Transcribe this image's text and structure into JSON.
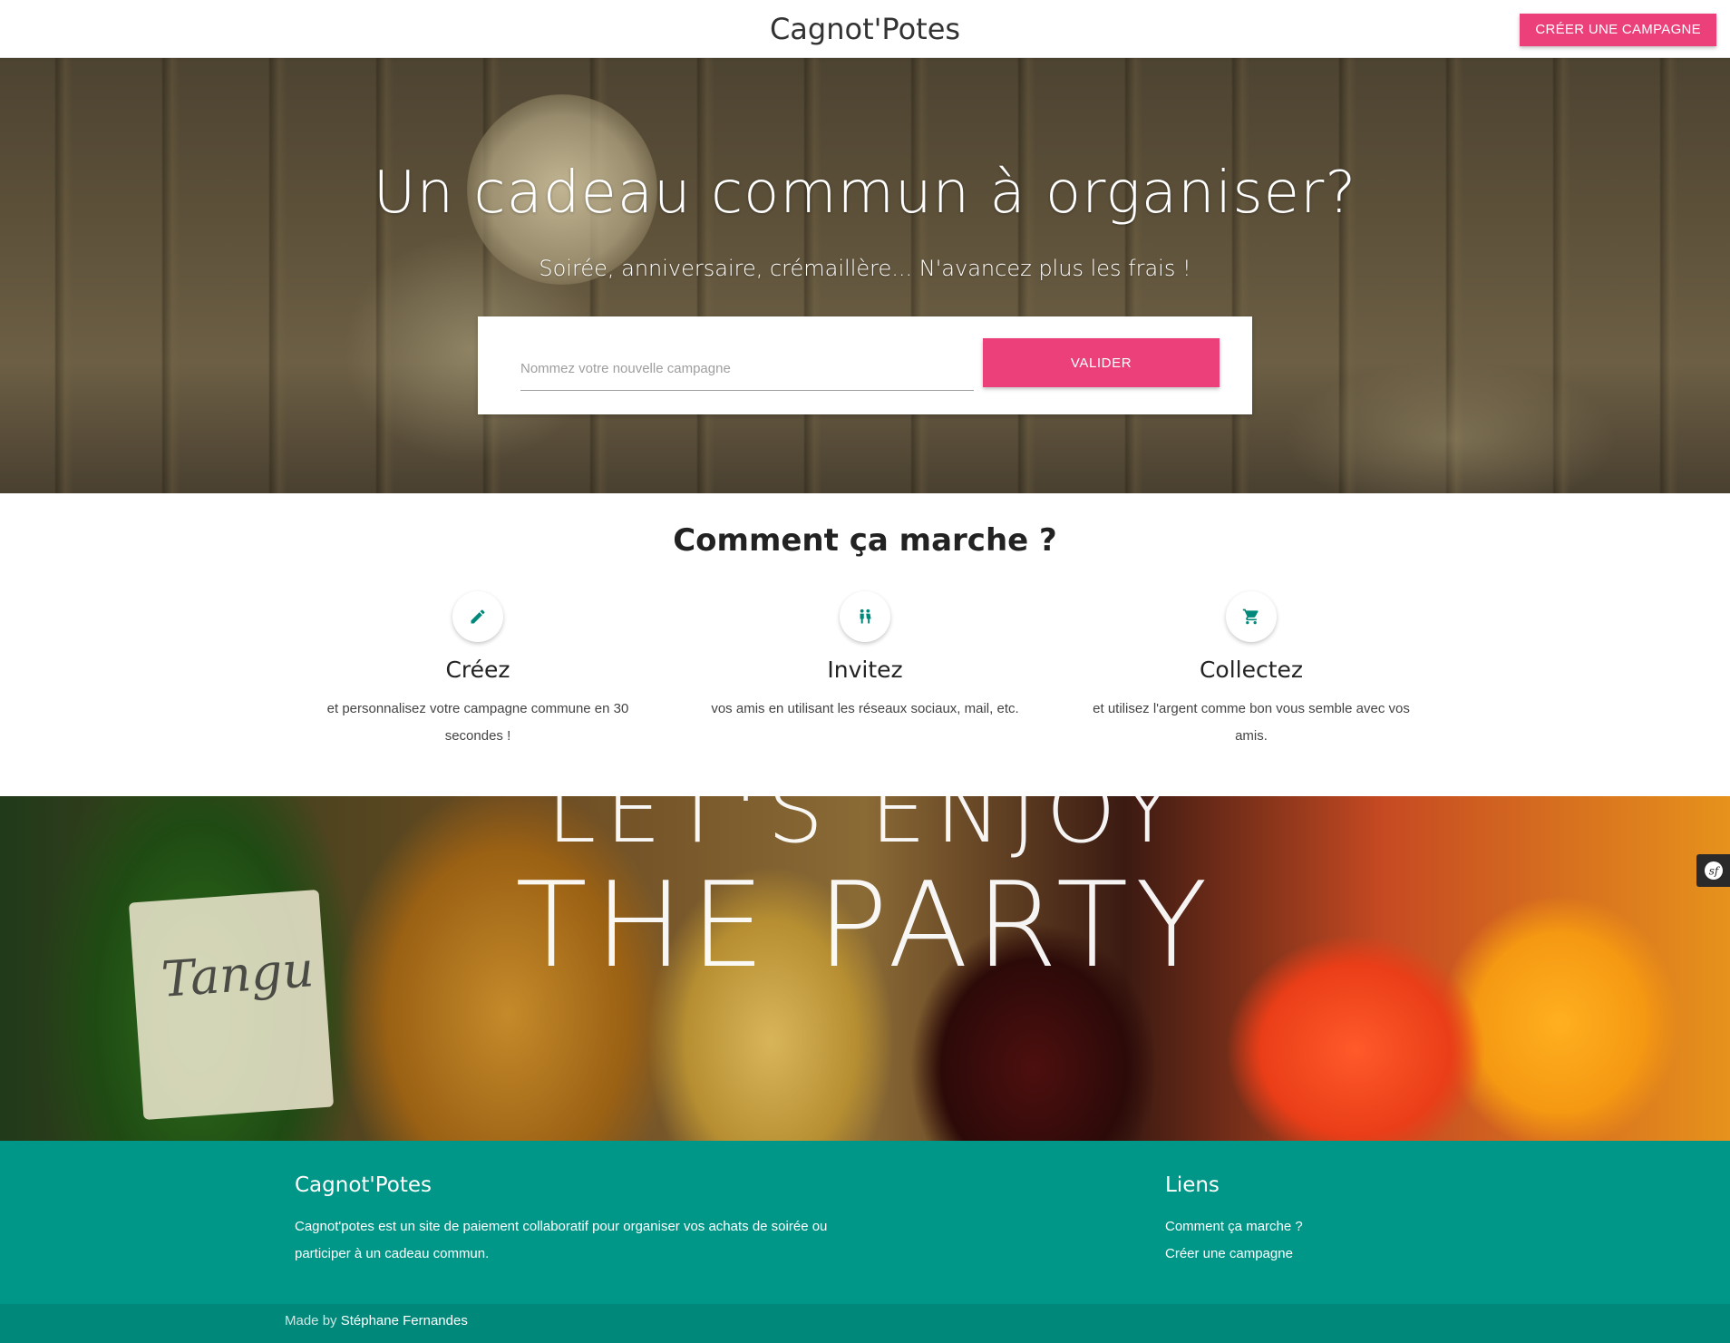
{
  "nav": {
    "brand": "Cagnot'Potes",
    "cta_label": "CRÉER UNE CAMPAGNE"
  },
  "hero": {
    "title": "Un cadeau commun à organiser?",
    "subtitle": "Soirée, anniversaire, crémaillère... N'avancez plus les frais !",
    "input_placeholder": "Nommez votre nouvelle campagne",
    "input_value": "",
    "submit_label": "VALIDER"
  },
  "how": {
    "title": "Comment ça marche ?",
    "steps": [
      {
        "icon": "pencil-icon",
        "title": "Créez",
        "text": "et personnalisez votre campagne commune en 30 secondes !"
      },
      {
        "icon": "people-icon",
        "title": "Invitez",
        "text": "vos amis en utilisant les réseaux sociaux, mail, etc."
      },
      {
        "icon": "cart-icon",
        "title": "Collectez",
        "text": "et utilisez l'argent comme bon vous semble avec vos amis."
      }
    ]
  },
  "banner": {
    "line1": "LET'S ENJOY",
    "line2": "THE PARTY",
    "bottle_label": "Tangu"
  },
  "footer": {
    "brand": "Cagnot'Potes",
    "description": "Cagnot'potes est un site de paiement collaboratif pour organiser vos achats de soirée ou participer à un cadeau commun.",
    "links_title": "Liens",
    "links": [
      "Comment ça marche ?",
      "Créer une campagne"
    ],
    "made_by_prefix": "Made by",
    "author": "Stéphane Fernandes"
  },
  "colors": {
    "accent": "#ec407a",
    "footer": "#009688",
    "icon": "#00897b"
  }
}
